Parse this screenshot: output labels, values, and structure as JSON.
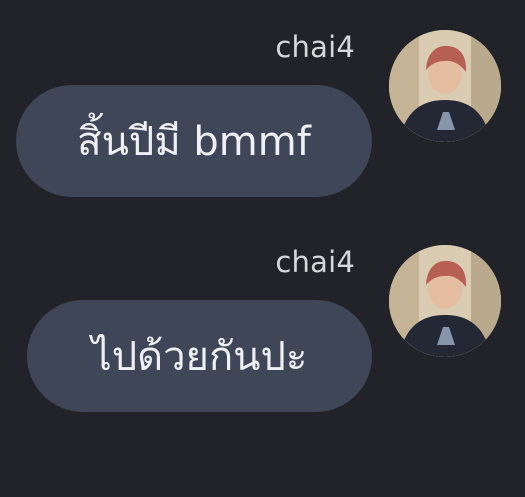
{
  "messages": [
    {
      "sender": "chai4",
      "text": "สิ้นปีมี bmmf",
      "avatar_icon": "user-avatar-photo"
    },
    {
      "sender": "chai4",
      "text": "ไปด้วยกันปะ",
      "avatar_icon": "user-avatar-photo"
    }
  ],
  "colors": {
    "background": "#222329",
    "bubble": "#3e4657",
    "bubble_text": "#eef0f4",
    "sender_text": "#d6d7db"
  }
}
